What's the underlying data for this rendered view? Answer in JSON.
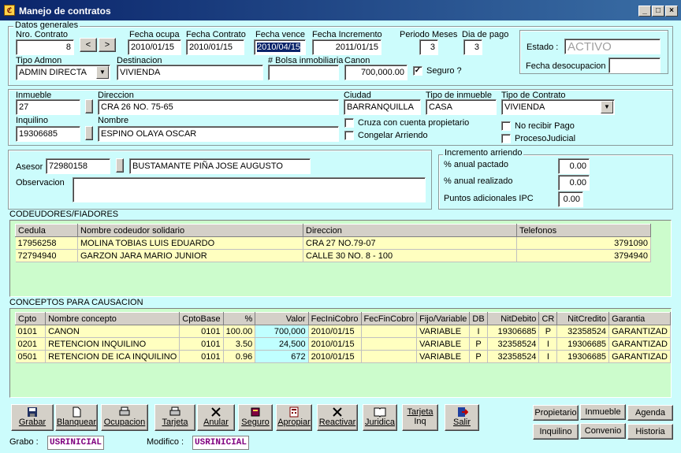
{
  "window": {
    "title": "Manejo de contratos"
  },
  "general": {
    "group_title": "Datos generales",
    "nro_contrato_label": "Nro. Contrato",
    "nro_contrato": "8",
    "prev_label": "<",
    "next_label": ">",
    "fecha_ocupa_label": "Fecha ocupa",
    "fecha_ocupa": "2010/01/15",
    "fecha_contrato_label": "Fecha Contrato",
    "fecha_contrato": "2010/01/15",
    "fecha_vence_label": "Fecha vence",
    "fecha_vence": "2010/04/15",
    "fecha_incremento_label": "Fecha Incremento",
    "fecha_incremento": "2011/01/15",
    "periodo_label": "Periodo Meses",
    "periodo": "3",
    "dia_pago_label": "Dia de pago",
    "dia_pago": "3",
    "estado_label": "Estado :",
    "estado": "ACTIVO",
    "fecha_desoc_label": "Fecha desocupacion :",
    "fecha_desoc": "",
    "tipo_admon_label": "Tipo Admon",
    "tipo_admon": "ADMIN DIRECTA",
    "destinacion_label": "Destinacion",
    "destinacion": "VIVIENDA",
    "bolsa_label": "# Bolsa inmobiliaria",
    "bolsa": "",
    "canon_label": "Canon",
    "canon": "700,000.00",
    "seguro_label": "Seguro ?",
    "seguro_checked": "✓"
  },
  "inmueble": {
    "inmueble_label": "Inmueble",
    "inmueble": "27",
    "direccion_label": "Direccion",
    "direccion": "CRA 26 NO. 75-65",
    "ciudad_label": "Ciudad",
    "ciudad": "BARRANQUILLA",
    "tipo_inmueble_label": "Tipo de inmueble",
    "tipo_inmueble": "CASA",
    "tipo_contrato_label": "Tipo de Contrato",
    "tipo_contrato": "VIVIENDA",
    "inquilino_label": "Inquilino",
    "inquilino": "19306685",
    "nombre_label": "Nombre",
    "nombre": "ESPINO OLAYA OSCAR",
    "cruza_label": "Cruza con cuenta propietario",
    "congelar_label": "Congelar Arriendo",
    "no_recibir_label": "No recibir Pago",
    "proceso_label": "ProcesoJudicial"
  },
  "asesor": {
    "asesor_label": "Asesor",
    "asesor_code": "72980158",
    "asesor_name": "BUSTAMANTE PIÑA JOSE AUGUSTO",
    "observacion_label": "Observacion",
    "observacion": ""
  },
  "incremento": {
    "group_title": "Incremento arriendo",
    "pactado_label": "% anual pactado",
    "pactado": "0.00",
    "realizado_label": "% anual realizado",
    "realizado": "0.00",
    "ipc_label": "Puntos adicionales IPC",
    "ipc": "0.00"
  },
  "codeudores": {
    "section_title": "CODEUDORES/FIADORES",
    "headers": [
      "Cedula",
      "Nombre codeudor solidario",
      "Direccion",
      "Telefonos"
    ],
    "rows": [
      [
        "17956258",
        "MOLINA TOBIAS LUIS EDUARDO",
        "CRA 27 NO.79-07",
        "3791090"
      ],
      [
        "72794940",
        "GARZON JARA MARIO JUNIOR",
        "CALLE 30 NO. 8 - 100",
        "3794940"
      ]
    ]
  },
  "conceptos": {
    "section_title": "CONCEPTOS PARA CAUSACION",
    "headers": [
      "Cpto",
      "Nombre concepto",
      "CptoBase",
      "%",
      "Valor",
      "FecIniCobro",
      "FecFinCobro",
      "Fijo/Variable",
      "DB",
      "NitDebito",
      "CR",
      "NitCredito",
      "Garantia"
    ],
    "rows": [
      [
        "0101",
        "CANON",
        "0101",
        "100.00",
        "700,000",
        "2010/01/15",
        "",
        "VARIABLE",
        "I",
        "19306685",
        "P",
        "32358524",
        "GARANTIZAD"
      ],
      [
        "0201",
        "RETENCION INQUILINO",
        "0101",
        "3.50",
        "24,500",
        "2010/01/15",
        "",
        "VARIABLE",
        "P",
        "32358524",
        "I",
        "19306685",
        "GARANTIZAD"
      ],
      [
        "0501",
        "RETENCION DE ICA INQUILINO",
        "0101",
        "0.96",
        "672",
        "2010/01/15",
        "",
        "VARIABLE",
        "P",
        "32358524",
        "I",
        "19306685",
        "GARANTIZAD"
      ]
    ]
  },
  "toolbar": {
    "grabar": "Grabar",
    "blanquear": "Blanquear",
    "ocupacion": "Ocupacion",
    "tarjeta": "Tarjeta",
    "anular": "Anular",
    "seguro": "Seguro",
    "apropiar": "Apropiar",
    "reactivar": "Reactivar",
    "juridica": "Juridica",
    "tarjeta_inq_1": "Tarjeta",
    "tarjeta_inq_2": "Inq",
    "salir": "Salir"
  },
  "nav": {
    "propietario": "Propietario",
    "inmueble": "Inmueble",
    "agenda": "Agenda",
    "inquilino": "Inquilino",
    "convenio": "Convenio",
    "historia": "Historia"
  },
  "footer": {
    "grabo_label": "Grabo :",
    "grabo": "USRINICIAL",
    "modifico_label": "Modifico :",
    "modifico": "USRINICIAL"
  }
}
